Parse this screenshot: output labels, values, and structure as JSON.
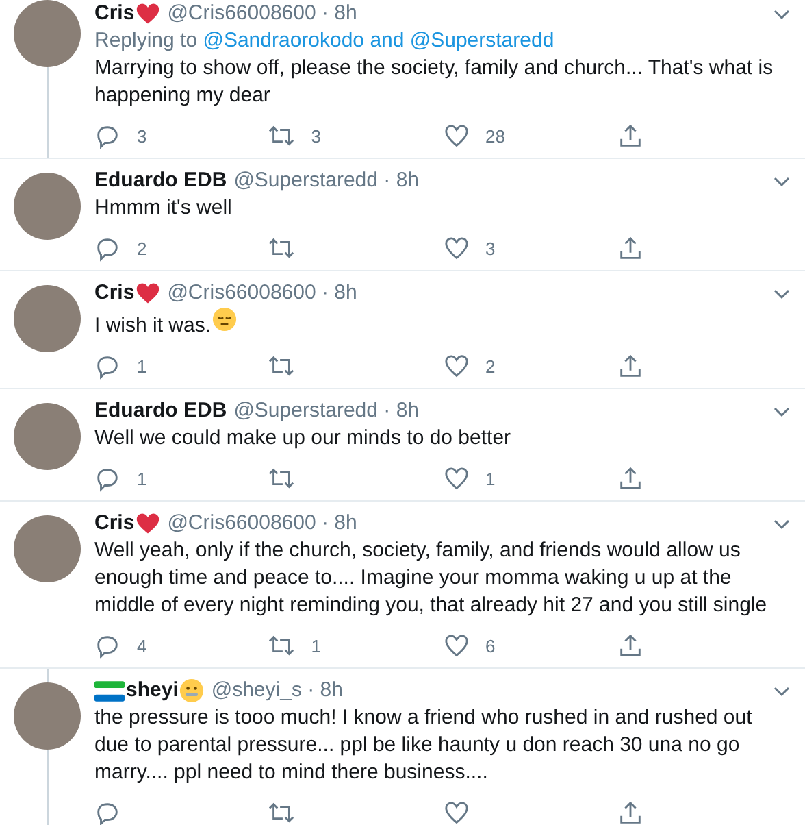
{
  "tweets": [
    {
      "name": "Cris",
      "name_icons": [
        {
          "kind": "heart"
        }
      ],
      "handle": "@Cris66008600",
      "separator": "·",
      "time": "8h",
      "replying": {
        "prefix": "Replying to",
        "to": "@Sandraorokodo and @Superstaredd"
      },
      "text": "Marrying to show off, please the society, family and church... That's what is happening my dear",
      "line_above": false,
      "line_below": true,
      "replies": "3",
      "retweets": "3",
      "likes": "28"
    },
    {
      "name": "Eduardo EDB",
      "handle": "@Superstaredd",
      "separator": "·",
      "time": "8h",
      "text": "Hmmm it's well",
      "line_above": false,
      "line_below": false,
      "replies": "2",
      "likes": "3"
    },
    {
      "name": "Cris",
      "name_icons": [
        {
          "kind": "heart"
        }
      ],
      "handle": "@Cris66008600",
      "separator": "·",
      "time": "8h",
      "text": "I wish it was.",
      "text_icons": [
        {
          "kind": "pensive-face"
        }
      ],
      "line_above": false,
      "line_below": false,
      "replies": "1",
      "likes": "2"
    },
    {
      "name": "Eduardo EDB",
      "handle": "@Superstaredd",
      "separator": "·",
      "time": "8h",
      "text": "Well we could make up our minds to do better",
      "line_above": false,
      "line_below": false,
      "replies": "1",
      "likes": "1"
    },
    {
      "name": "Cris",
      "name_icons": [
        {
          "kind": "heart"
        }
      ],
      "handle": "@Cris66008600",
      "separator": "·",
      "time": "8h",
      "text": "Well yeah, only if the church, society, family, and friends would allow us enough time and peace to.... Imagine your momma waking u up at the middle of every night reminding you, that already hit 27 and you still single",
      "line_above": false,
      "line_below": false,
      "replies": "4",
      "retweets": "1",
      "likes": "6"
    },
    {
      "name": "sheyi",
      "prefix_icons": [
        {
          "kind": "flag"
        }
      ],
      "name_icons": [
        {
          "kind": "zipper-face"
        }
      ],
      "handle": "@sheyi_s",
      "separator": "·",
      "time": "8h",
      "text": "the pressure is tooo much! I know a friend who rushed in and rushed out due to parental pressure... ppl be like haunty u don reach 30 una no go marry.... ppl need to mind there business....",
      "line_above": true,
      "line_below": true
    }
  ]
}
